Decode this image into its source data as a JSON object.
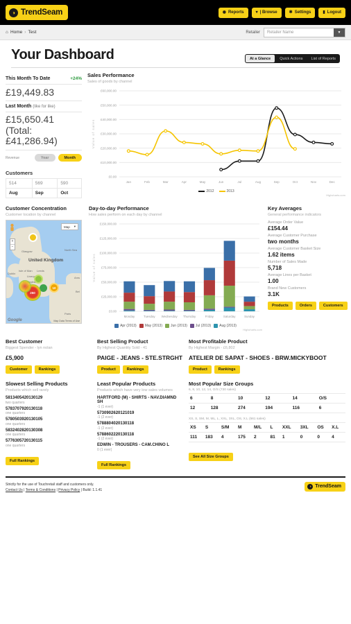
{
  "brand": {
    "name": "TrendSeam",
    "mark_glyph": "◑"
  },
  "topnav": {
    "buttons": [
      {
        "label": "Reports",
        "icon": "eye-icon",
        "glyph": "◉"
      },
      {
        "label": "| Browse",
        "icon": "caret-down-icon",
        "glyph": "▾"
      },
      {
        "label": "Settings",
        "icon": "gear-icon",
        "glyph": "✱"
      },
      {
        "label": "Logout",
        "icon": "lock-icon",
        "glyph": "🔒"
      }
    ]
  },
  "breadcrumb": {
    "home": "Home",
    "separator": "›",
    "current": "Test",
    "retailer_label": "Retailer",
    "retailer_value": "Retailer Name"
  },
  "page": {
    "title": "Your Dashboard",
    "tabs": [
      {
        "label": "At a Glance",
        "active": true
      },
      {
        "label": "Quick Actions",
        "active": false
      },
      {
        "label": "List of Reports",
        "active": false
      }
    ]
  },
  "kpi": {
    "this_month_label": "This Month To Date",
    "this_month_delta": "+24%",
    "this_month_value": "£19,449.83",
    "last_month_label": "Last Month",
    "last_month_qualifier": "(like for like)",
    "last_month_value": "£15,650.41",
    "last_month_total": "(Total: £41,286.94)",
    "revenue_label": "Revenue",
    "toggle_year": "Year",
    "toggle_month": "Month",
    "customers_title": "Customers",
    "customers_values": [
      "514",
      "569",
      "590"
    ],
    "customers_months": [
      "Aug",
      "Sep",
      "Oct"
    ]
  },
  "sales_panel": {
    "title": "Sales Performance",
    "subtitle": "Sales of goods by channel",
    "credit": "Highcharts.com"
  },
  "map_panel": {
    "title": "Customer Concentration",
    "subtitle": "Customer location by channel",
    "map_type": "Map",
    "caret": "▾",
    "zoom_in": "+",
    "zoom_out": "−",
    "labels": [
      {
        "text": "United Kingdom",
        "big": true
      },
      {
        "text": "Glasgow",
        "big": false
      },
      {
        "text": "Leeds",
        "big": false
      },
      {
        "text": "Liverpool",
        "big": false
      },
      {
        "text": "Birmingham",
        "big": false
      },
      {
        "text": "Isle of Man",
        "big": false
      },
      {
        "text": "Dublin",
        "big": false
      },
      {
        "text": "North Sea",
        "big": false
      },
      {
        "text": "Paris",
        "big": false
      },
      {
        "text": "Ams",
        "big": false
      },
      {
        "text": "Bel",
        "big": false
      }
    ],
    "clusters": [
      "10",
      "250",
      "11"
    ],
    "attribution": "Map Data   Terms of Use",
    "watermark": "Google"
  },
  "day_panel": {
    "title": "Day-to-day Performance",
    "subtitle": "How sales perform on each day by channel",
    "credit": "Highcharts.com"
  },
  "key_averages": {
    "title": "Key Averages",
    "subtitle": "General performance indicators",
    "items": [
      {
        "label": "Average Order Value",
        "value": "£154.44"
      },
      {
        "label": "Average Customer Purchase",
        "value": "two months"
      },
      {
        "label": "Average Customer Basket Size",
        "value": "1.62 items"
      },
      {
        "label": "Number of Sales Made",
        "value": "5,718"
      },
      {
        "label": "Average Lines per Basket",
        "value": "1.00"
      },
      {
        "label": "Brand New Customers",
        "value": "3.1K"
      }
    ],
    "buttons": [
      "Products",
      "Orders",
      "Customers"
    ]
  },
  "highlights": [
    {
      "title": "Best Customer",
      "subtitle": "Biggest Spender - lyn nolan",
      "value": "£5,900",
      "buttons": [
        "Customer",
        "Rankings"
      ]
    },
    {
      "title": "Best Selling Product",
      "subtitle": "By Highest Quantity Sold - 41",
      "value": "PAIGE - JEANS - STE.STRGHT",
      "buttons": [
        "Product",
        "Rankings"
      ]
    },
    {
      "title": "Most Profitable Product",
      "subtitle": "By Highest Margin - £6,802",
      "value": "ATELIER DE SAPAT - SHOES - BRW.MICKYBOOT",
      "buttons": [
        "Product",
        "Rankings"
      ]
    }
  ],
  "slowest": {
    "title": "Slowest Selling Products",
    "subtitle": "Products which sell rarely",
    "items": [
      {
        "name": "5813405420130129",
        "sub": "two quarters"
      },
      {
        "name": "5783707920130118",
        "sub": "one quarters"
      },
      {
        "name": "5780503920130105",
        "sub": "one quarters"
      },
      {
        "name": "5832402820130308",
        "sub": "one quarters"
      },
      {
        "name": "5776305720130115",
        "sub": "one quarters"
      }
    ],
    "button": "Full Rankings"
  },
  "least_popular": {
    "title": "Least Popular Products",
    "subtitle": "Products which have very low sales volumes",
    "items": [
      {
        "name": "HARTFORD (M) - SHIRTS - NAV.DIAMND SH",
        "sub": "-1 (1 ever)"
      },
      {
        "name": "5730902620121019",
        "sub": "-1 (2 ever)"
      },
      {
        "name": "5788804020130118",
        "sub": "-1 (2 ever)"
      },
      {
        "name": "5788602220130118",
        "sub": "-1 (2 ever)"
      },
      {
        "name": "EDWIN - TROUSERS - CAM.CHINO L",
        "sub": "0 (1 ever)"
      }
    ],
    "button": "Full Rankings"
  },
  "size_groups": {
    "title": "Most Popular Size Groups",
    "button": "See All Size Groups",
    "tables": [
      {
        "caption": "6, 8, 10, 12, 14, O/S (730 sales)",
        "headers": [
          "6",
          "8",
          "10",
          "12",
          "14",
          "O/S"
        ],
        "values": [
          "12",
          "128",
          "274",
          "194",
          "116",
          "6"
        ]
      },
      {
        "caption": "XS, S, SM, M, ML, L, XXL, 3XL, OS, X.L (561 sales)",
        "headers": [
          "XS",
          "S",
          "S/M",
          "M",
          "M/L",
          "L",
          "XXL",
          "3XL",
          "OS",
          "X.L"
        ],
        "values": [
          "111",
          "183",
          "4",
          "175",
          "2",
          "81",
          "1",
          "0",
          "0",
          "4"
        ]
      }
    ]
  },
  "footer": {
    "notice": "Strictly for the use of Touchretail staff and customers only.",
    "links": [
      "Contact Us",
      "Terms & Conditions",
      "Privacy Policy"
    ],
    "build": "Build: 1.1.41",
    "separator": " | ",
    "brand": "TrendSeam"
  },
  "colors": {
    "brand_yellow": "#f7d117",
    "black": "#000000",
    "series_2012": "#1a1a1a",
    "series_2013": "#f5c400",
    "bar_apr": "#3a6fa8",
    "bar_may": "#b03a3a",
    "bar_jun": "#84ab52",
    "bar_jul": "#6d4e8c",
    "bar_aug": "#2d94ae",
    "positive": "#2d9a3e"
  },
  "chart_data": [
    {
      "type": "line",
      "title": "Sales Performance",
      "subtitle": "Sales of goods by channel",
      "xlabel": "",
      "ylabel": "Value of sales",
      "categories": [
        "Jan",
        "Feb",
        "Mar",
        "Apr",
        "May",
        "Jun",
        "Jul",
        "Aug",
        "Sep",
        "Oct",
        "Nov",
        "Dec"
      ],
      "ylim": [
        0,
        60000
      ],
      "ytick_labels": [
        "£0.00",
        "£10,000.00",
        "£20,000.00",
        "£30,000.00",
        "£40,000.00",
        "£50,000.00",
        "£60,000.00"
      ],
      "ytick_values": [
        0,
        10000,
        20000,
        30000,
        40000,
        50000,
        60000
      ],
      "grid": true,
      "legend_position": "bottom",
      "series": [
        {
          "name": "2012",
          "color": "#1a1a1a",
          "values": [
            null,
            null,
            null,
            null,
            null,
            5000,
            11000,
            11000,
            48000,
            29500,
            24000,
            23000
          ]
        },
        {
          "name": "2013",
          "color": "#f5c400",
          "values": [
            18000,
            15500,
            32000,
            24000,
            23000,
            16000,
            18500,
            18000,
            41500,
            19500,
            null,
            null
          ]
        }
      ]
    },
    {
      "type": "bar",
      "stacked": true,
      "title": "Day-to-day Performance",
      "subtitle": "How sales perform on each day by channel",
      "xlabel": "",
      "ylabel": "Value of sales",
      "categories": [
        "Monday",
        "Tuesday",
        "Wednesday",
        "Thursday",
        "Friday",
        "Saturday",
        "Sunday"
      ],
      "ylim": [
        0,
        150000
      ],
      "ytick_labels": [
        "£0.00",
        "£25,000.00",
        "£50,000.00",
        "£75,000.00",
        "£100,000.00",
        "£125,000.00",
        "£150,000.00"
      ],
      "ytick_values": [
        0,
        25000,
        50000,
        75000,
        100000,
        125000,
        150000
      ],
      "grid": true,
      "legend_position": "bottom",
      "series": [
        {
          "name": "Apr (2013)",
          "color": "#3a6fa8",
          "values": [
            19500,
            19000,
            18000,
            18500,
            21000,
            34000,
            9000
          ]
        },
        {
          "name": "May (2013)",
          "color": "#b03a3a",
          "values": [
            15500,
            13000,
            17500,
            17500,
            26000,
            43000,
            7500
          ]
        },
        {
          "name": "Jun (2013)",
          "color": "#84ab52",
          "values": [
            12500,
            10500,
            13500,
            13000,
            23000,
            36000,
            5500
          ]
        },
        {
          "name": "Jul (2013)",
          "color": "#6d4e8c",
          "values": [
            2500,
            1500,
            2000,
            1500,
            2000,
            1500,
            0
          ]
        },
        {
          "name": "Aug (2013)",
          "color": "#2d94ae",
          "values": [
            1500,
            1000,
            1000,
            1000,
            2500,
            6500,
            3500
          ]
        }
      ]
    }
  ]
}
